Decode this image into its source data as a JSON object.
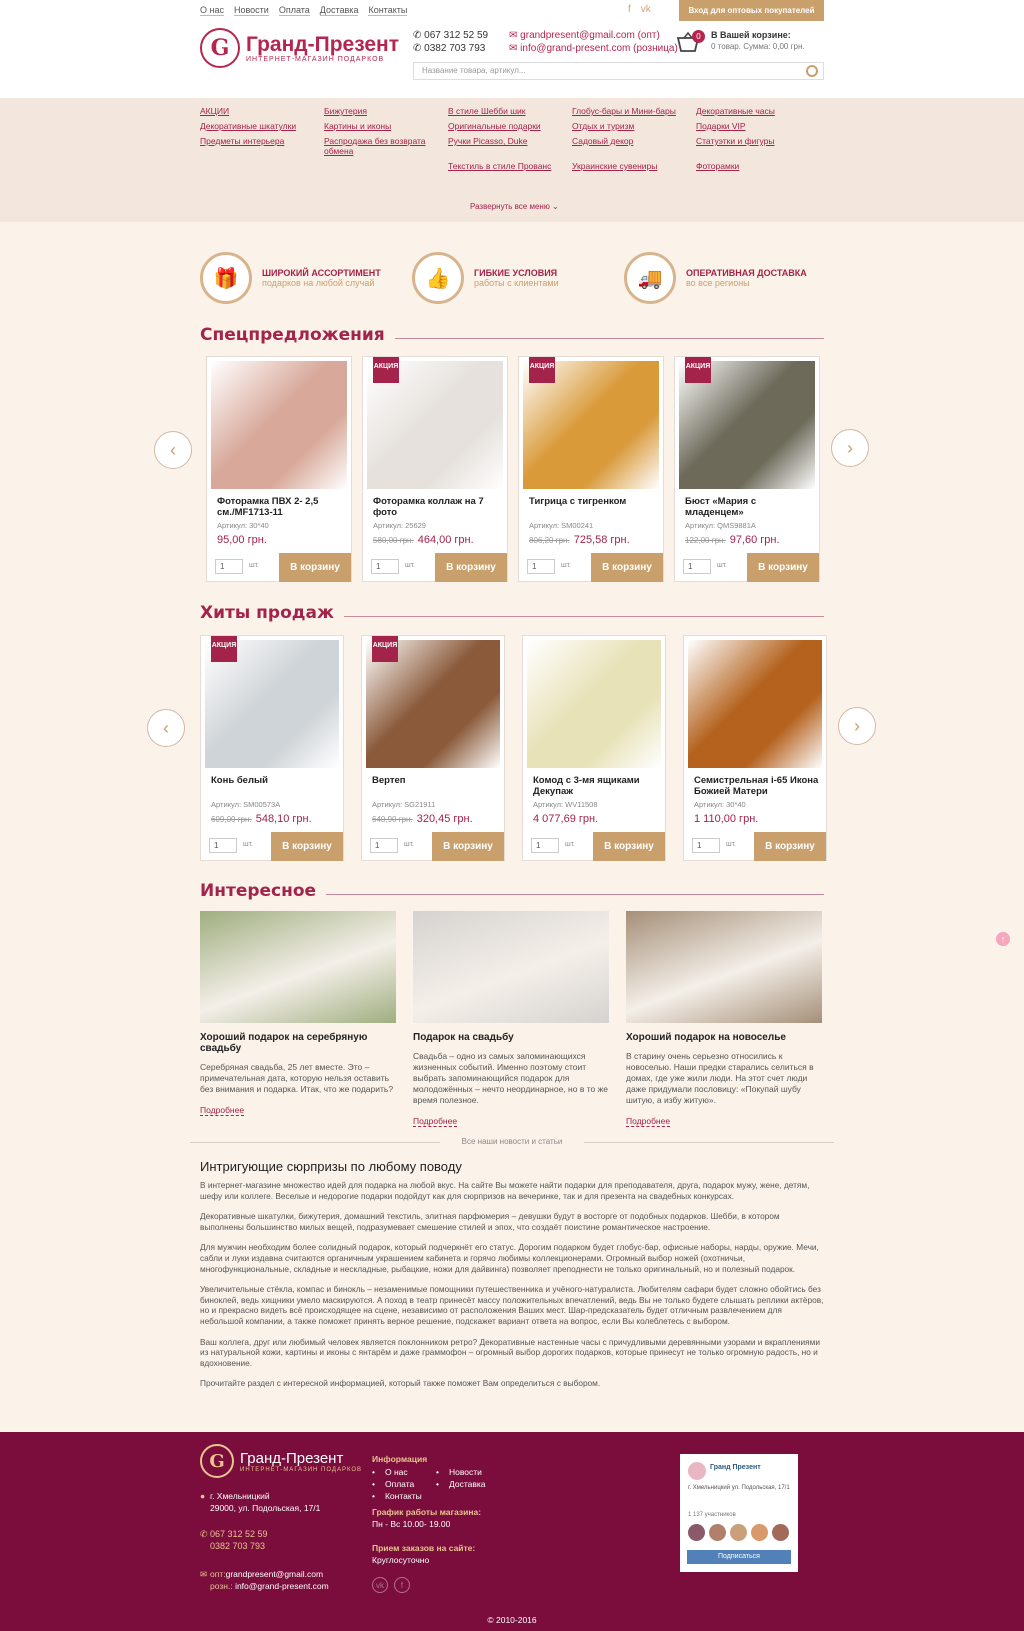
{
  "top": {
    "links": [
      "О нас",
      "Новости",
      "Оплата",
      "Доставка",
      "Контакты"
    ],
    "wholesale": "Вход для оптовых покупателей"
  },
  "header": {
    "logo_mark": "G",
    "logo_title": "Гранд-Презент",
    "logo_sub": "ИНТЕРНЕТ-МАГАЗИН ПОДАРКОВ",
    "phone1": "067 312 52 59",
    "phone2": "0382 703 793",
    "email1": "grandpresent@gmail.com (опт)",
    "email2": "info@grand-present.com (розница)",
    "cart_count": "0",
    "cart_title": "В Вашей корзине:",
    "cart_sum": "0 товар. Сумма: 0,00 грн.",
    "search_placeholder": "Название товара, артикул..."
  },
  "categories": [
    "АКЦИИ",
    "Бижутерия",
    "В стиле Шебби шик",
    "Глобус-бары и Мини-бары",
    "Декоративные часы",
    "Декоративные шкатулки",
    "Картины и иконы",
    "Оригинальные подарки",
    "Отдых и туризм",
    "Подарки VIP",
    "Предметы интерьера",
    "Распродажа без возврата обмена",
    "Ручки Picasso, Duke",
    "Садовый декор",
    "Статуэтки и фигуры",
    "",
    "",
    "Текстиль в стиле Прованс",
    "Украинские сувениры",
    "Фоторамки"
  ],
  "expand_menu": "Развернуть все меню ⌄",
  "features": [
    {
      "icon": "gift-icon",
      "glyph": "🎁",
      "title": "ШИРОКИЙ АССОРТИМЕНТ",
      "sub": "подарков на любой случай"
    },
    {
      "icon": "thumbs-up-icon",
      "glyph": "👍",
      "title": "ГИБКИЕ УСЛОВИЯ",
      "sub": "работы с клиентами"
    },
    {
      "icon": "truck-icon",
      "glyph": "🚚",
      "title": "ОПЕРАТИВНАЯ ДОСТАВКА",
      "sub": "во все регионы"
    }
  ],
  "special": {
    "title": "Спецпредложения",
    "items": [
      {
        "name": "Фоторамка ПВХ 2- 2,5 см./MF1713-11",
        "sku": "Артикул: 30*40",
        "old": "",
        "price": "95,00 грн.",
        "sale": false,
        "color": "#d8a99a"
      },
      {
        "name": "Фоторамка коллаж на 7 фото",
        "sku": "Артикул: 25629",
        "old": "580,00 грн.",
        "price": "464,00 грн.",
        "sale": true,
        "color": "#e6e1dc"
      },
      {
        "name": "Тигрица с тигренком",
        "sku": "Артикул: SM00241",
        "old": "806,20 грн.",
        "price": "725,58 грн.",
        "sale": true,
        "color": "#d99a3a"
      },
      {
        "name": "Бюст «Мария с младенцем»",
        "sku": "Артикул: QMS9881A",
        "old": "122,00 грн.",
        "price": "97,60 грн.",
        "sale": true,
        "color": "#6d6a5a"
      }
    ]
  },
  "hits": {
    "title": "Хиты продаж",
    "items": [
      {
        "name": "Конь белый",
        "sku": "Артикул: SM00573A",
        "old": "609,00 грн.",
        "price": "548,10 грн.",
        "sale": true,
        "color": "#cfd4d8"
      },
      {
        "name": "Вертеп",
        "sku": "Артикул: SG21911",
        "old": "640,90 грн.",
        "price": "320,45 грн.",
        "sale": true,
        "color": "#8a5a3a"
      },
      {
        "name": "Комод с 3-мя ящиками Декупаж",
        "sku": "Артикул: WV11508",
        "old": "",
        "price": "4 077,69 грн.",
        "sale": false,
        "color": "#e8e2b8"
      },
      {
        "name": "Семистрельная i-65 Икона Божией Матери",
        "sku": "Артикул: 30*40",
        "old": "",
        "price": "1 110,00 грн.",
        "sale": false,
        "color": "#b4621e"
      }
    ]
  },
  "card_labels": {
    "sale": "АКЦИЯ",
    "unit": "шт.",
    "buy": "В корзину",
    "qty": "1"
  },
  "interesting": {
    "title": "Интересное",
    "more": "Подробнее",
    "items": [
      {
        "title": "Хороший подарок на серебряную свадьбу",
        "text": "Серебряная свадьба, 25 лет вместе. Это – примечательная дата, которую нельзя оставить без внимания и подарка. Итак, что же подарить?",
        "color": "#9fae7f"
      },
      {
        "title": "Подарок на свадьбу",
        "text": "Свадьба – одно из самых запоминающихся жизненных событий. Именно поэтому стоит выбрать запоминающийся подарок для молодожённых – нечто неординарное, но в то же время полезное.",
        "color": "#d6d2cf"
      },
      {
        "title": "Хороший подарок на новоселье",
        "text": "В старину очень серьезно относились к новоселью. Наши предки старались селиться в домах, где уже жили люди. На этот счет люди даже придумали пословицу: «Покупай шубу шитую, а избу житую».",
        "color": "#a58f78"
      }
    ],
    "all": "Все наши новости и статьи"
  },
  "seo": {
    "title": "Интригующие сюрпризы по любому поводу",
    "paragraphs": [
      "В интернет-магазине множество идей для подарка на любой вкус. На сайте Вы можете найти подарки для преподавателя, друга, подарок мужу, жене, детям, шефу или коллеге. Веселые и недорогие подарки подойдут как для сюрпризов на вечеринке, так и для презента на свадебных конкурсах.",
      "Декоративные шкатулки, бижутерия, домашний текстиль, элитная парфюмерия – девушки будут в восторге от подобных подарков. Шебби, в котором выполнены большинство милых вещей, подразумевает смешение стилей и эпох, что создаёт поистине романтическое настроение.",
      "Для мужчин необходим более солидный подарок, который подчеркнёт его статус. Дорогим подарком будет глобус-бар, офисные наборы, нарды, оружие. Мечи, сабли и луки издавна считаются органичным украшением кабинета и горячо любимы коллекционерами. Огромный выбор ножей (охотничьи, многофункциональные, складные и нескладные, рыбацкие, ножи для дайвинга) позволяет преподнести не только оригинальный, но и полезный подарок.",
      "Увеличительные стёкла, компас и бинокль – незаменимые помощники путешественника и учёного-натуралиста. Любителям сафари будет сложно обойтись без биноклей, ведь хищники умело маскируются. А поход в театр принесёт массу положительных впечатлений, ведь Вы не только будете слышать реплики актёров, но и прекрасно видеть всё происходящее на сцене, независимо от расположения Ваших мест. Шар-предсказатель будет отличным развлечением для небольшой компании, а также поможет принять верное решение, подскажет вариант ответа на вопрос, если Вы колеблетесь с выбором.",
      "Ваш коллега, друг или любимый человек является поклонником ретро? Декоративные настенные часы с причудливыми деревянными узорами и вкраплениями из натуральной кожи, картины и иконы с янтарём и даже граммофон – огромный выбор дорогих подарков, которые принесут не только огромную радость, но и вдохновение.",
      "Прочитайте раздел с интересной информацией, который также поможет Вам определиться с выбором."
    ]
  },
  "footer": {
    "logo_title": "Гранд-Презент",
    "logo_sub": "ИНТЕРНЕТ-МАГАЗИН ПОДАРКОВ",
    "city": "г. Хмельницкий",
    "address": "29000, ул. Подольская, 17/1",
    "phone1": "067 312 52 59",
    "phone2": "0382 703 793",
    "mail_opt_label": "опт:",
    "mail_opt": "grandpresent@gmail.com",
    "mail_retail_label": "розн.:",
    "mail_retail": "info@grand-present.com",
    "info_title": "Информация",
    "menu": [
      "О нас",
      "Новости",
      "Оплата",
      "Доставка",
      "Контакты"
    ],
    "schedule_title": "График работы магазина:",
    "schedule": "Пн - Вс 10.00- 19.00",
    "accept_title": "Прием заказов на сайте:",
    "accept": "Круглосуточно",
    "vk_name": "Гранд Презент",
    "vk_addr": "г. Хмельницкий ул. Подольская, 17/1",
    "vk_count": "1 137 участников",
    "vk_btn": "Подписаться",
    "copyright": "© 2010-2016"
  }
}
